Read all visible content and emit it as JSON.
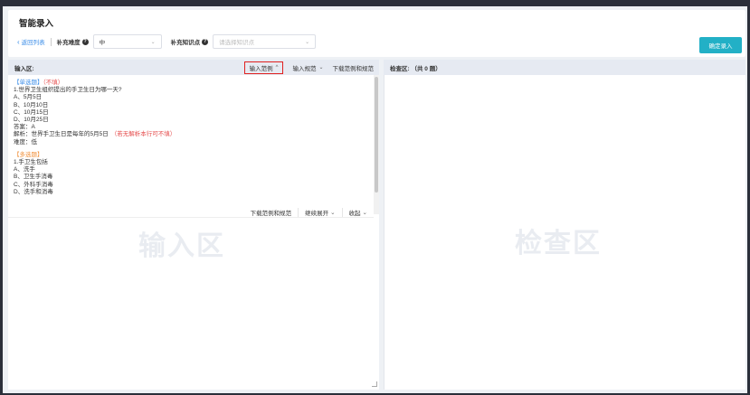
{
  "header": {
    "title": "智能录入",
    "back_label": "返回列表",
    "difficulty_label": "补充难度",
    "difficulty_value": "中",
    "knowledge_label": "补充知识点",
    "knowledge_placeholder": "请选择知识点",
    "confirm_label": "确定录入"
  },
  "input_panel": {
    "title": "输入区:",
    "actions": {
      "example": "输入范例",
      "spec": "输入规范",
      "download": "下载范例和规范"
    },
    "example_lines": {
      "q1_tag": "【单选题】",
      "q1_note": "（不填）",
      "q1_stem": "1.世界卫生组织提出的手卫生日为哪一天?",
      "q1_a": "A、5月5日",
      "q1_b": "B、10月10日",
      "q1_c": "C、10月15日",
      "q1_d": "D、10月25日",
      "q1_answer": "答案：A",
      "q1_analysis": "解析：世界手卫生日是每年的5月5日",
      "q1_analysis_note": "（若无解析本行可不填）",
      "q1_difficulty": "难度：低",
      "q2_tag": "【多选题】",
      "q2_stem": "1.手卫生包括",
      "q2_a": "A、洗手",
      "q2_b": "B、卫生手消毒",
      "q2_c": "C、外科手消毒",
      "q2_d": "D、洗手和消毒"
    },
    "bottom_actions": {
      "download": "下载范例和规范",
      "expand": "继续展开",
      "collapse": "收起"
    },
    "watermark": "输入区"
  },
  "check_panel": {
    "title": "检查区: （共 0 题）",
    "watermark": "检查区"
  },
  "colors": {
    "accent": "#22b0c6",
    "link": "#3c8ee8",
    "highlight_border": "#e02020",
    "note_red": "#e54b4b",
    "multi_tag": "#f0903a"
  },
  "icons": {
    "back": "chevron-left-icon",
    "help": "question-circle-icon",
    "dropdown": "chevron-down-icon"
  }
}
